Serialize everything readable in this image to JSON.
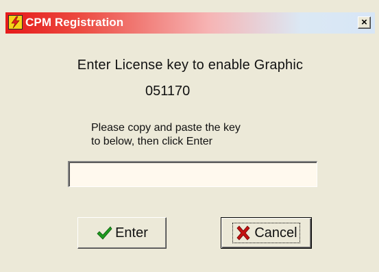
{
  "window": {
    "title": "CPM Registration",
    "close_label": "×"
  },
  "content": {
    "heading": "Enter License key to enable Graphic",
    "code": "051170",
    "instructions_line1": "Please copy and paste the key",
    "instructions_line2": "to below, then click Enter"
  },
  "key_input": {
    "value": "",
    "placeholder": ""
  },
  "buttons": {
    "enter_label": "Enter",
    "cancel_label": "Cancel"
  },
  "icons": {
    "app": "lightning-icon",
    "enter": "checkmark-icon",
    "cancel": "x-icon"
  },
  "colors": {
    "title_bar_start": "#e51a1a",
    "title_bar_end": "#d7e6f6",
    "dialog_background": "#ece9d8",
    "input_background": "#fff9ee",
    "check_green": "#1e9a1e",
    "cancel_red": "#c41212"
  }
}
